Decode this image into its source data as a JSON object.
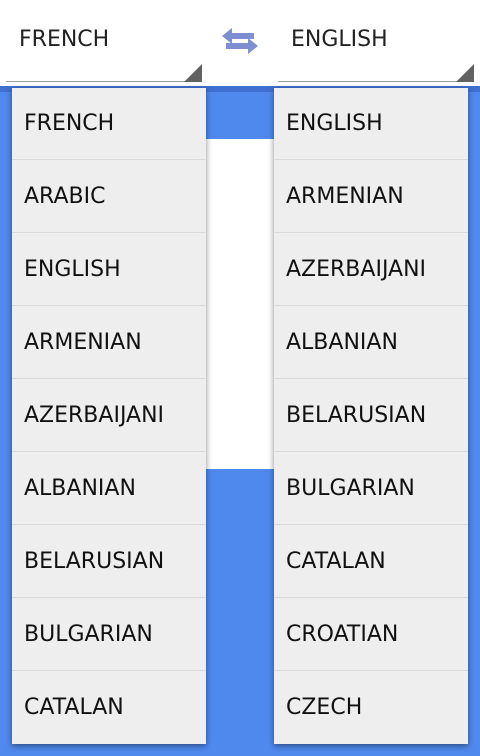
{
  "source_spinner": {
    "selected": "FRENCH",
    "options": [
      "FRENCH",
      "ARABIC",
      "ENGLISH",
      "ARMENIAN",
      "AZERBAIJANI",
      "ALBANIAN",
      "BELARUSIAN",
      "BULGARIAN",
      "CATALAN"
    ]
  },
  "target_spinner": {
    "selected": "ENGLISH",
    "options": [
      "ENGLISH",
      "ARMENIAN",
      "AZERBAIJANI",
      "ALBANIAN",
      "BELARUSIAN",
      "BULGARIAN",
      "CATALAN",
      "CROATIAN",
      "CZECH"
    ]
  },
  "swap_icon": "swap-arrows-icon",
  "colors": {
    "accent_blue": "#5089ee",
    "swap_icon": "#7e8fd1",
    "dropdown_bg": "#eeeeee"
  }
}
